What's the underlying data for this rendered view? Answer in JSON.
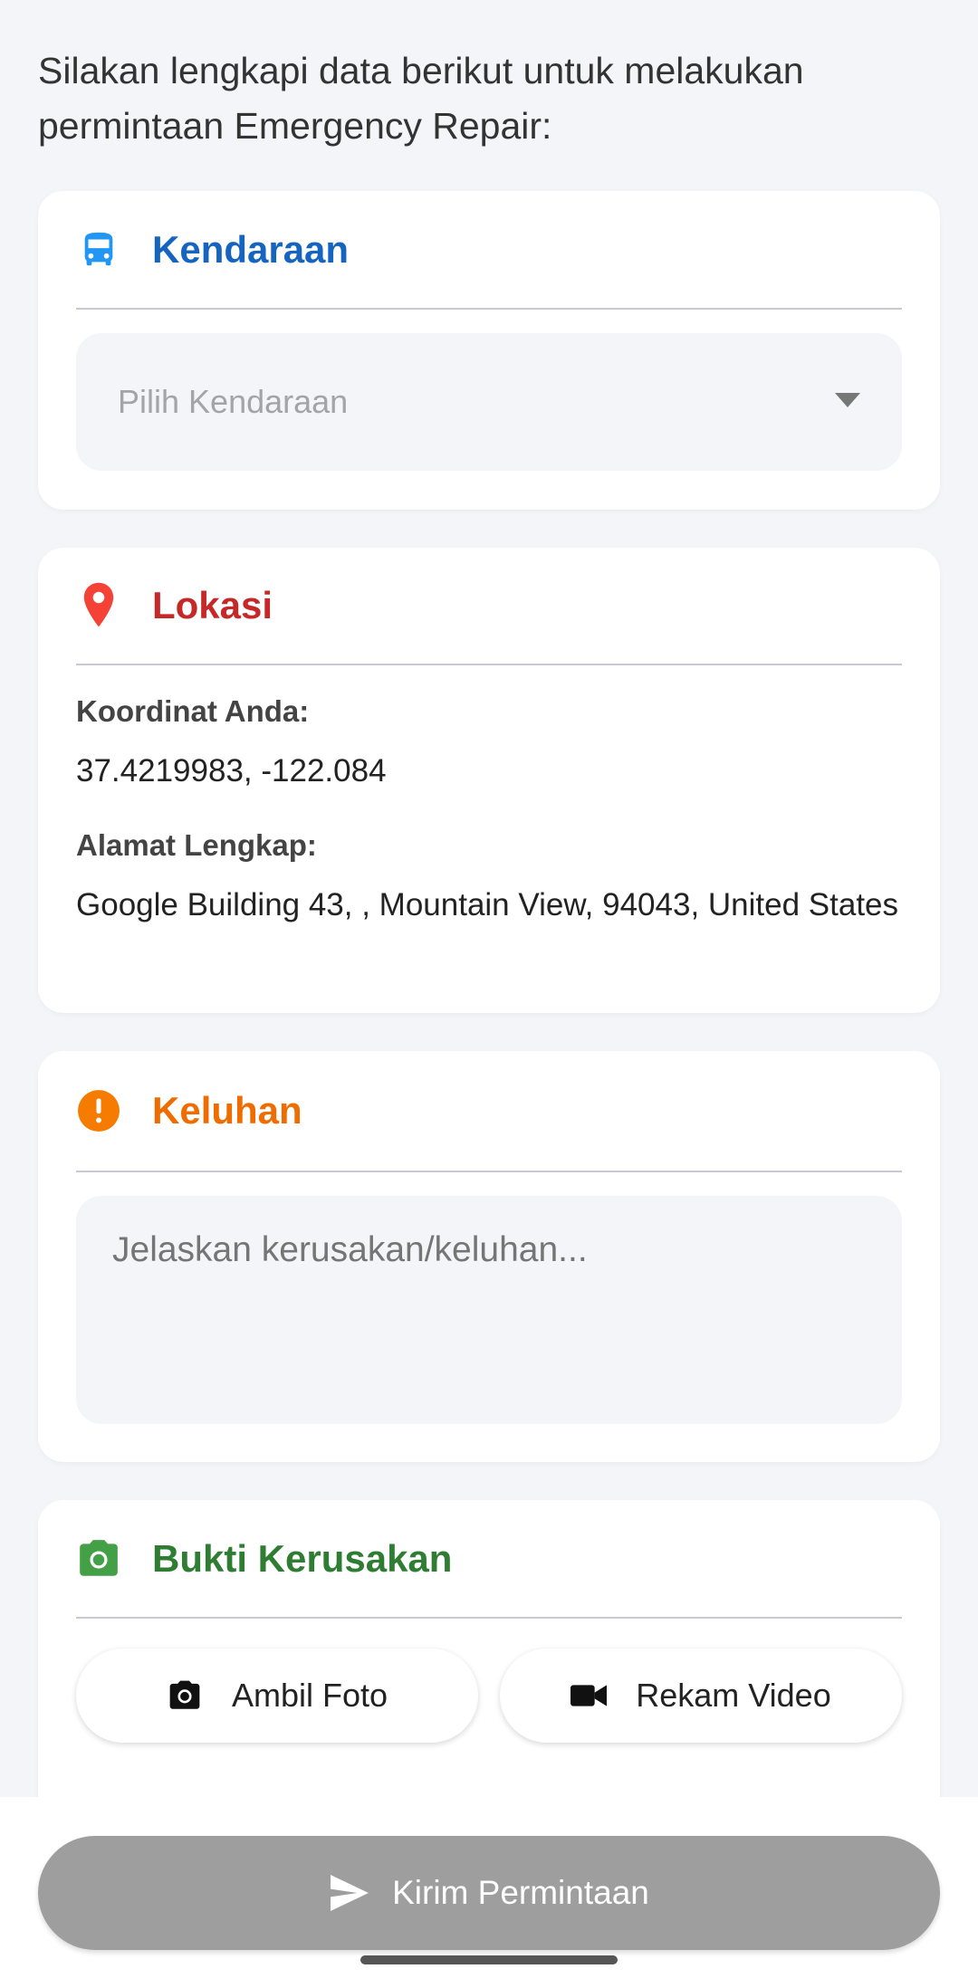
{
  "intro": "Silakan lengkapi data berikut untuk melakukan permintaan Emergency Repair:",
  "vehicle": {
    "title": "Kendaraan",
    "placeholder": "Pilih Kendaraan",
    "icon": "bus-icon",
    "color": "#1565c0"
  },
  "location": {
    "title": "Lokasi",
    "icon": "location-pin-icon",
    "color": "#c62828",
    "coordinates_label": "Koordinat Anda:",
    "coordinates": "37.4219983, -122.084",
    "address_label": "Alamat Lengkap:",
    "address": "Google Building 43, , Mountain View, 94043, United States"
  },
  "complaint": {
    "title": "Keluhan",
    "icon": "alert-circle-icon",
    "color": "#ef6c00",
    "placeholder": "Jelaskan kerusakan/keluhan..."
  },
  "evidence": {
    "title": "Bukti Kerusakan",
    "icon": "camera-icon",
    "color": "#2e7d32",
    "photo_label": "Ambil Foto",
    "video_label": "Rekam Video"
  },
  "submit": {
    "label": "Kirim Permintaan",
    "icon": "send-icon"
  }
}
